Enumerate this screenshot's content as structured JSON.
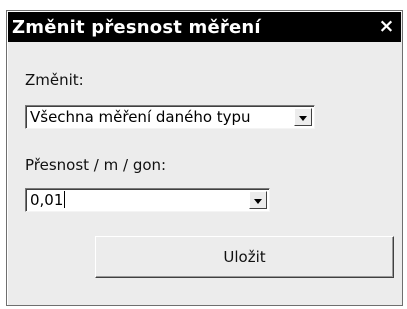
{
  "window": {
    "title": "Změnit přesnost měření",
    "close_glyph": "×"
  },
  "change": {
    "label": "Změnit:",
    "selected": "Všechna měření daného typu"
  },
  "precision": {
    "label": "Přesnost / m / gon:",
    "value": "0,01"
  },
  "actions": {
    "save_label": "Uložit"
  }
}
